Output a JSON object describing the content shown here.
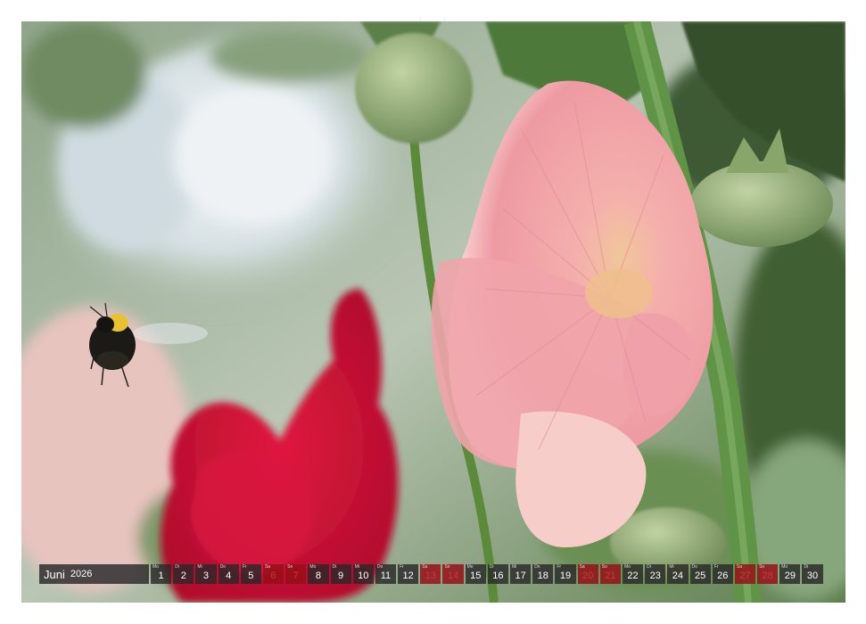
{
  "calendar": {
    "month": "Juni",
    "year": "2026",
    "days": [
      {
        "wd": "Mo",
        "n": "1",
        "we": false
      },
      {
        "wd": "Di",
        "n": "2",
        "we": false
      },
      {
        "wd": "Mi",
        "n": "3",
        "we": false
      },
      {
        "wd": "Do",
        "n": "4",
        "we": false
      },
      {
        "wd": "Fr",
        "n": "5",
        "we": false
      },
      {
        "wd": "Sa",
        "n": "6",
        "we": true
      },
      {
        "wd": "So",
        "n": "7",
        "we": true
      },
      {
        "wd": "Mo",
        "n": "8",
        "we": false
      },
      {
        "wd": "Di",
        "n": "9",
        "we": false
      },
      {
        "wd": "Mi",
        "n": "10",
        "we": false
      },
      {
        "wd": "Do",
        "n": "11",
        "we": false
      },
      {
        "wd": "Fr",
        "n": "12",
        "we": false
      },
      {
        "wd": "Sa",
        "n": "13",
        "we": true
      },
      {
        "wd": "So",
        "n": "14",
        "we": true
      },
      {
        "wd": "Mo",
        "n": "15",
        "we": false
      },
      {
        "wd": "Di",
        "n": "16",
        "we": false
      },
      {
        "wd": "Mi",
        "n": "17",
        "we": false
      },
      {
        "wd": "Do",
        "n": "18",
        "we": false
      },
      {
        "wd": "Fr",
        "n": "19",
        "we": false
      },
      {
        "wd": "Sa",
        "n": "20",
        "we": true
      },
      {
        "wd": "So",
        "n": "21",
        "we": true
      },
      {
        "wd": "Mo",
        "n": "22",
        "we": false
      },
      {
        "wd": "Di",
        "n": "23",
        "we": false
      },
      {
        "wd": "Mi",
        "n": "24",
        "we": false
      },
      {
        "wd": "Do",
        "n": "25",
        "we": false
      },
      {
        "wd": "Fr",
        "n": "26",
        "we": false
      },
      {
        "wd": "Sa",
        "n": "27",
        "we": true
      },
      {
        "wd": "So",
        "n": "28",
        "we": true
      },
      {
        "wd": "Mo",
        "n": "29",
        "we": false
      },
      {
        "wd": "Di",
        "n": "30",
        "we": false
      }
    ]
  },
  "colors": {
    "weekday_bg": "#282828",
    "weekend_bg": "#960f19",
    "weekend_text": "#c73a3f",
    "hollyhock_pink": "#f2a7ab",
    "bud_green": "#9fb384"
  }
}
